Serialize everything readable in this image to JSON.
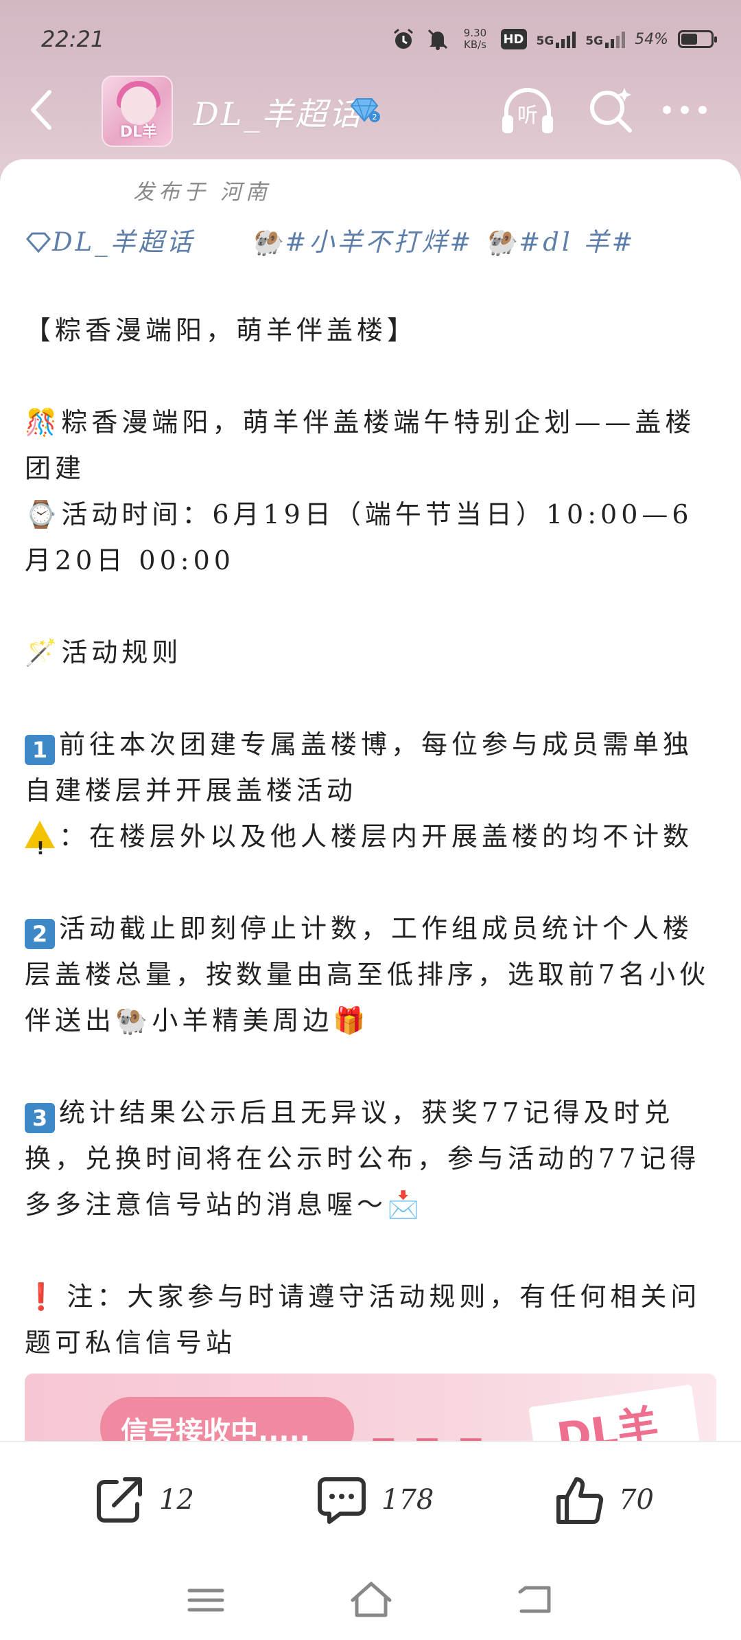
{
  "status_bar": {
    "time": "22:21",
    "net_speed_value": "9.30",
    "net_speed_unit": "KB/s",
    "hd_label": "HD",
    "sim1_label": "5G",
    "sim2_label": "5G",
    "battery_pct": "54%",
    "battery_level": 0.54
  },
  "nav": {
    "title": "DL_羊超话",
    "avatar_text": "DL羊",
    "listen_label": "听"
  },
  "post": {
    "published_from": "发布于 河南",
    "tags": {
      "topic": "DL_羊超话",
      "tag1": "#小羊不打烊#",
      "tag2": "#dl 羊#"
    },
    "headline": "【粽香漫端阳，萌羊伴盖楼】",
    "intro": "粽香漫端阳，萌羊伴盖楼端午特别企划——盖楼团建",
    "time_line": "活动时间：6月19日（端午节当日）10:00—6月20日 00:00",
    "rules_title": "活动规则",
    "rule1": "前往本次团建专属盖楼博，每位参与成员需单独自建楼层并开展盖楼活动",
    "rule1_warning": "：在楼层外以及他人楼层内开展盖楼的均不计数",
    "rule2": "活动截止即刻停止计数，工作组成员统计个人楼层盖楼总量，按数量由高至低排序，选取前7名小伙伴送出",
    "rule2_tail": "小羊精美周边",
    "rule3": "统计结果公示后且无异议，获奖77记得及时兑换，兑换时间将在公示时公布，参与活动的77记得多多注意信号站的消息喔～",
    "note": "注：大家参与时请遵守活动规则，有任何相关问题可私信信号站",
    "num1": "1",
    "num2": "2",
    "num3": "3",
    "preview_text": "信号接收中.....",
    "preview_dashes": "▬ ▬ ▬",
    "preview_logo": "DL羊"
  },
  "actions": {
    "share_count": "12",
    "comment_count": "178",
    "like_count": "70"
  },
  "icons": {
    "back": "back-arrow-icon",
    "diamond": "diamond-badge-icon",
    "listen": "headphones-icon",
    "search": "sparkle-search-icon",
    "more": "more-dots-icon",
    "share": "share-icon",
    "comment": "comment-icon",
    "like": "thumbs-up-icon"
  },
  "colors": {
    "tag_blue": "#5d7ea8",
    "number_box": "#3f88c8",
    "header_pink": "#d9bfc9"
  }
}
